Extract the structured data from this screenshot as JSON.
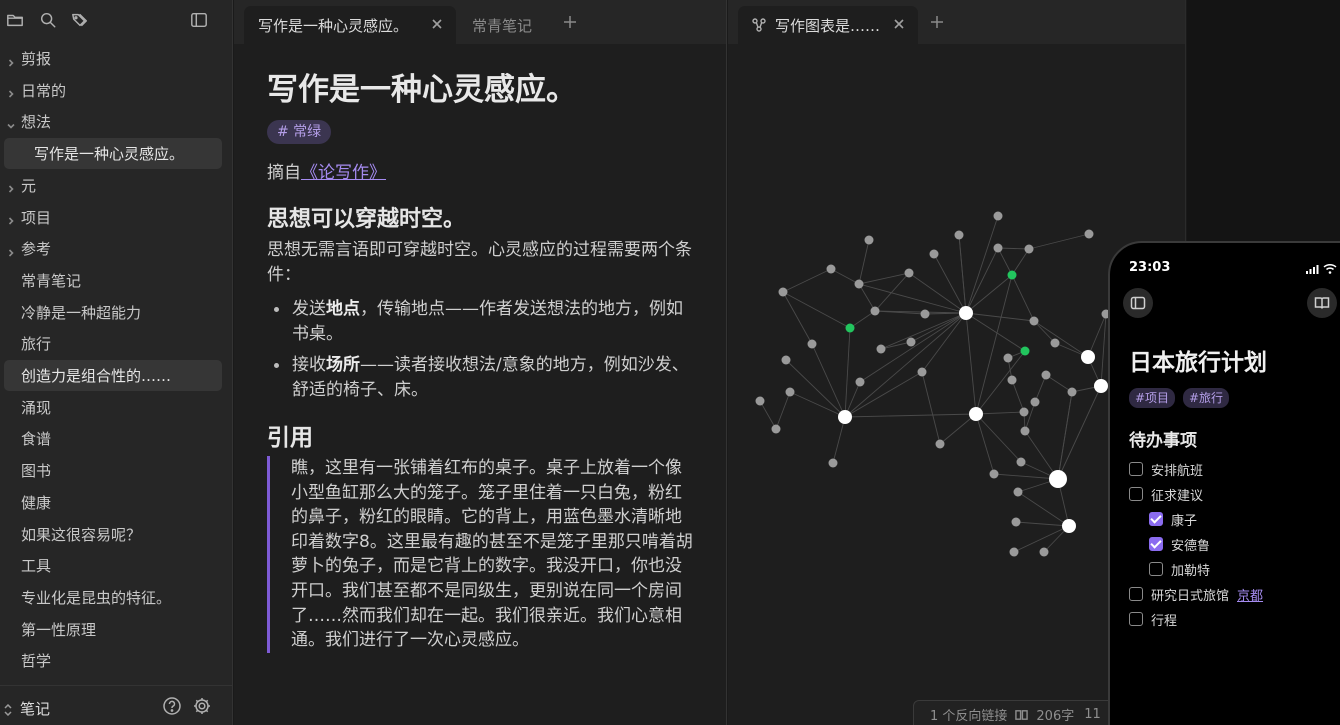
{
  "sidebar": {
    "icons": [
      "folder-icon",
      "search-icon",
      "tags-icon",
      "sidebar-toggle-icon"
    ],
    "items": [
      {
        "label": "剪报",
        "chev": "right",
        "child": false,
        "selected": false
      },
      {
        "label": "日常的",
        "chev": "right",
        "child": false,
        "selected": false
      },
      {
        "label": "想法",
        "chev": "down",
        "child": false,
        "selected": false
      },
      {
        "label": "写作是一种心灵感应。",
        "chev": "",
        "child": true,
        "selected": true
      },
      {
        "label": "元",
        "chev": "right",
        "child": false,
        "selected": false
      },
      {
        "label": "项目",
        "chev": "right",
        "child": false,
        "selected": false
      },
      {
        "label": "参考",
        "chev": "right",
        "child": false,
        "selected": false
      },
      {
        "label": "常青笔记",
        "chev": "",
        "child": false,
        "selected": false
      },
      {
        "label": "冷静是一种超能力",
        "chev": "",
        "child": false,
        "selected": false
      },
      {
        "label": "旅行",
        "chev": "",
        "child": false,
        "selected": false
      },
      {
        "label": "创造力是组合性的……",
        "chev": "",
        "child": false,
        "selected": true
      },
      {
        "label": "涌现",
        "chev": "",
        "child": false,
        "selected": false
      },
      {
        "label": "食谱",
        "chev": "",
        "child": false,
        "selected": false
      },
      {
        "label": "图书",
        "chev": "",
        "child": false,
        "selected": false
      },
      {
        "label": "健康",
        "chev": "",
        "child": false,
        "selected": false
      },
      {
        "label": "如果这很容易呢？",
        "chev": "",
        "child": false,
        "selected": false
      },
      {
        "label": "工具",
        "chev": "",
        "child": false,
        "selected": false
      },
      {
        "label": "专业化是昆虫的特征。",
        "chev": "",
        "child": false,
        "selected": false
      },
      {
        "label": "第一性原理",
        "chev": "",
        "child": false,
        "selected": false
      },
      {
        "label": "哲学",
        "chev": "",
        "child": false,
        "selected": false
      }
    ],
    "vault_name": "笔记"
  },
  "left_pane": {
    "tabs": [
      {
        "label": "写作是一种心灵感应。",
        "active": true
      },
      {
        "label": "常青笔记",
        "active": false
      }
    ]
  },
  "note": {
    "title": "写作是一种心灵感应。",
    "tag": "# 常绿",
    "excerpt_prefix": "摘自",
    "excerpt_link": "《论写作》",
    "h2": "思想可以穿越时空。",
    "p1": "思想无需言语即可穿越时空。心灵感应的过程需要两个条件：",
    "bullet1": {
      "pre": "发送",
      "bold": "地点",
      "post": "，传输地点——作者发送想法的地方，例如书桌。"
    },
    "bullet2": {
      "pre": "接收",
      "bold": "场所",
      "post": "——读者接收想法/意象的地方，例如沙发、舒适的椅子、床。"
    },
    "h3": "引用",
    "quote": "瞧，这里有一张铺着红布的桌子。桌子上放着一个像小型鱼缸那么大的笼子。笼子里住着一只白兔，粉红的鼻子，粉红的眼睛。它的背上，用蓝色墨水清晰地印着数字8。这里最有趣的甚至不是笼子里那只啃着胡萝卜的兔子，而是它背上的数字。我没开口，你也没开口。我们甚至都不是同级生，更别说在同一个房间了……然而我们却在一起。我们很亲近。我们心意相通。我们进行了一次心灵感应。"
  },
  "right_pane": {
    "tab_label": "写作图表是……",
    "status_backlinks": "1 个反向链接",
    "status_words": "206字",
    "status_extra": "11"
  },
  "colors": {
    "accent": "#8b6cf0",
    "link": "#a58bf0",
    "graph_node": "#9a9a9a",
    "graph_highlight": "#22c55e",
    "graph_edge": "#4a4a4a"
  },
  "phone": {
    "time": "23:03",
    "title": "日本旅行计划",
    "tags": [
      "#项目",
      "#旅行"
    ],
    "todo_heading": "待办事项",
    "todos": [
      {
        "label": "安排航班",
        "checked": false,
        "indent": 0,
        "link": ""
      },
      {
        "label": "征求建议",
        "checked": false,
        "indent": 0,
        "link": ""
      },
      {
        "label": "康子",
        "checked": true,
        "indent": 1,
        "link": ""
      },
      {
        "label": "安德鲁",
        "checked": true,
        "indent": 1,
        "link": ""
      },
      {
        "label": "加勒特",
        "checked": false,
        "indent": 1,
        "link": ""
      },
      {
        "label": "研究日式旅馆",
        "checked": false,
        "indent": 0,
        "link": "京都"
      },
      {
        "label": "行程",
        "checked": false,
        "indent": 0,
        "link": ""
      }
    ]
  }
}
